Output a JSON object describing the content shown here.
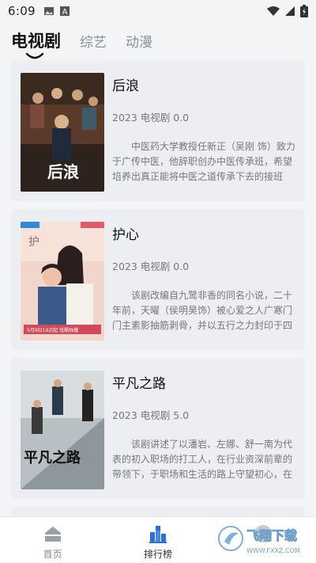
{
  "status_bar": {
    "time": "6:09",
    "icons": [
      "image-icon",
      "a-icon",
      "wifi-icon",
      "signal-icon",
      "battery-icon"
    ]
  },
  "tabs": [
    {
      "label": "电视剧",
      "active": true
    },
    {
      "label": "综艺",
      "active": false
    },
    {
      "label": "动漫",
      "active": false
    }
  ],
  "items": [
    {
      "title": "后浪",
      "meta": "2023 电视剧 0.0",
      "desc": "中医药大学教授任新正（吴刚 饰）致力于广传中医，他辞职创办中医传承班，希望培养出真正能将中医之道传承下去的接班人。混不吝孙头头（赵露…",
      "poster_text": "后浪"
    },
    {
      "title": "护心",
      "meta": "2023 电视剧 0.0",
      "desc": "该剧改编自九鹭非香的同名小说，二十年前，天曜（侯明昊饰）被心爱之人广寒门门主素影抽筋剥骨，并以五行之力封印于四方。机缘巧合之中，天曜于…",
      "poster_text": "5月9日19点起 优酷独播"
    },
    {
      "title": "平凡之路",
      "meta": "2023 电视剧 5.0",
      "desc": "该剧讲述了以潘岩、左娜、舒一南为代表的初入职场的打工人，在行业资深前辈的带领下，于职场和生活的路上守望初心，在平凡中创造不凡的“奋…",
      "poster_text": "平凡之路"
    }
  ],
  "bottom_nav": [
    {
      "label": "首页",
      "icon": "home-icon",
      "active": false
    },
    {
      "label": "排行榜",
      "icon": "ranking-icon",
      "active": true
    },
    {
      "label": "",
      "icon": "profile-icon",
      "active": false
    }
  ],
  "watermark": {
    "text": "飞翔下载",
    "site": "WWW.FXXZ.COM"
  },
  "colors": {
    "background": "#f3f4f6",
    "card": "#eceef1",
    "accent": "#2f6fd8"
  }
}
